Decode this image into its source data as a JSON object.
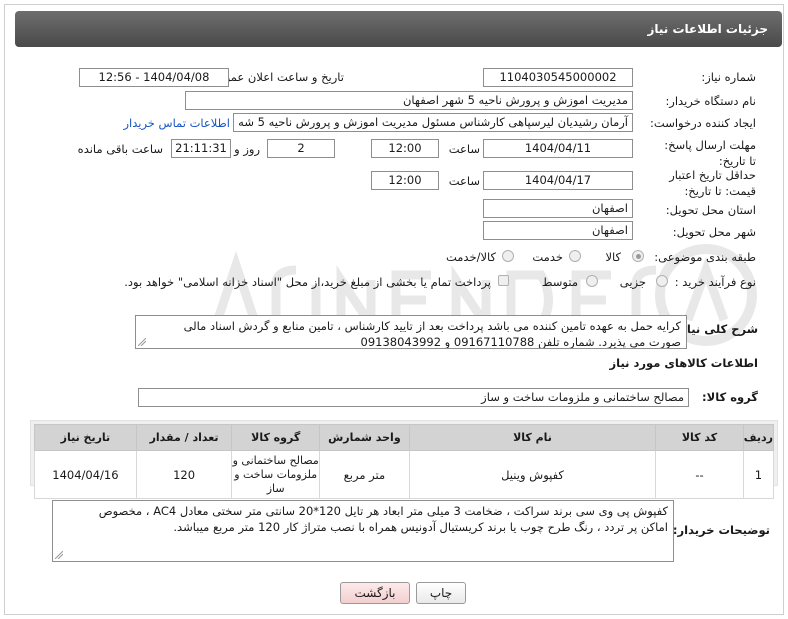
{
  "header": {
    "title": "جزئیات اطلاعات نیاز"
  },
  "fields": {
    "need_number_label": "شماره نیاز:",
    "need_number": "1104030545000002",
    "announce_label": "تاریخ و ساعت اعلان عمومی:",
    "announce_value": "1404/04/08 - 12:56",
    "buyer_org_label": "نام دستگاه خریدار:",
    "buyer_org": "مدیریت اموزش و پرورش ناحیه 5 شهر اصفهان",
    "requester_label": "ایجاد کننده درخواست:",
    "requester": "آرمان رشیدیان لیرسپاهی کارشناس مسئول مدیریت اموزش و پرورش ناحیه 5 شه",
    "contact_link": "اطلاعات تماس خریدار",
    "reply_deadline_label": "مهلت ارسال پاسخ: تا تاریخ:",
    "reply_date": "1404/04/11",
    "time_label": "ساعت",
    "reply_time": "12:00",
    "days_count": "2",
    "day_and_label": "روز و",
    "remaining_time": "21:11:31",
    "remaining_label": "ساعت باقی مانده",
    "price_validity_label": "حداقل تاریخ اعتبار قیمت: تا تاریخ:",
    "validity_date": "1404/04/17",
    "validity_time": "12:00",
    "province_label": "استان محل تحویل:",
    "province": "اصفهان",
    "city_label": "شهر محل تحویل:",
    "city": "اصفهان",
    "category_label": "طبقه بندی موضوعی:",
    "category_options": [
      "کالا",
      "خدمت",
      "کالا/خدمت"
    ],
    "purchase_type_label": "نوع فرآیند خرید :",
    "purchase_options": [
      "جزیی",
      "متوسط"
    ],
    "payment_note": "پرداخت تمام یا بخشی از مبلغ خرید،از محل \"اسناد خزانه اسلامی\" خواهد بود.",
    "general_desc_label": "شرح کلی نیاز:",
    "general_desc_line1": "کرایه حمل به عهده تامین کننده می باشد پرداخت بعد از تایید کارشناس ، تامین منابع و گردش اسناد مالی",
    "general_desc_line2": "صورت می پذیرد. شماره تلفن 09167110788 و 09138043992"
  },
  "goods_section": {
    "title": "اطلاعات کالاهای مورد نیاز",
    "group_label": "گروه کالا:",
    "group_value": "مصالح ساختمانی و ملزومات ساخت و ساز"
  },
  "table": {
    "headers": [
      "ردیف",
      "کد کالا",
      "نام کالا",
      "واحد شمارش",
      "گروه کالا",
      "تعداد / مقدار",
      "تاریخ نیاز"
    ],
    "rows": [
      {
        "row": "1",
        "code": "--",
        "name": "کفپوش وینیل",
        "unit": "متر مربع",
        "group": "مصالح ساختمانی و ملزومات ساخت و ساز",
        "qty": "120",
        "date": "1404/04/16"
      }
    ]
  },
  "buyer_notes": {
    "label": "توضیحات خریدار:",
    "line1": "کفپوش پی وی سی برند سراکت ، ضخامت 3 میلی متر ابعاد هر تایل 120*20 سانتی متر سختی معادل AC4 ، مخصوص",
    "line2": "اماکن پر تردد ، رنگ طرح چوب یا برند کریستیال آدونیس همراه با نصب متراژ کار 120 متر مربع میباشد."
  },
  "buttons": {
    "print": "چاپ",
    "back": "بازگشت"
  },
  "colors": {
    "header": "#4f4f4f",
    "link": "#1a56c4",
    "back_button": "#f3cfcf"
  },
  "icons": {
    "watermark": "ariatender-watermark-icon"
  }
}
